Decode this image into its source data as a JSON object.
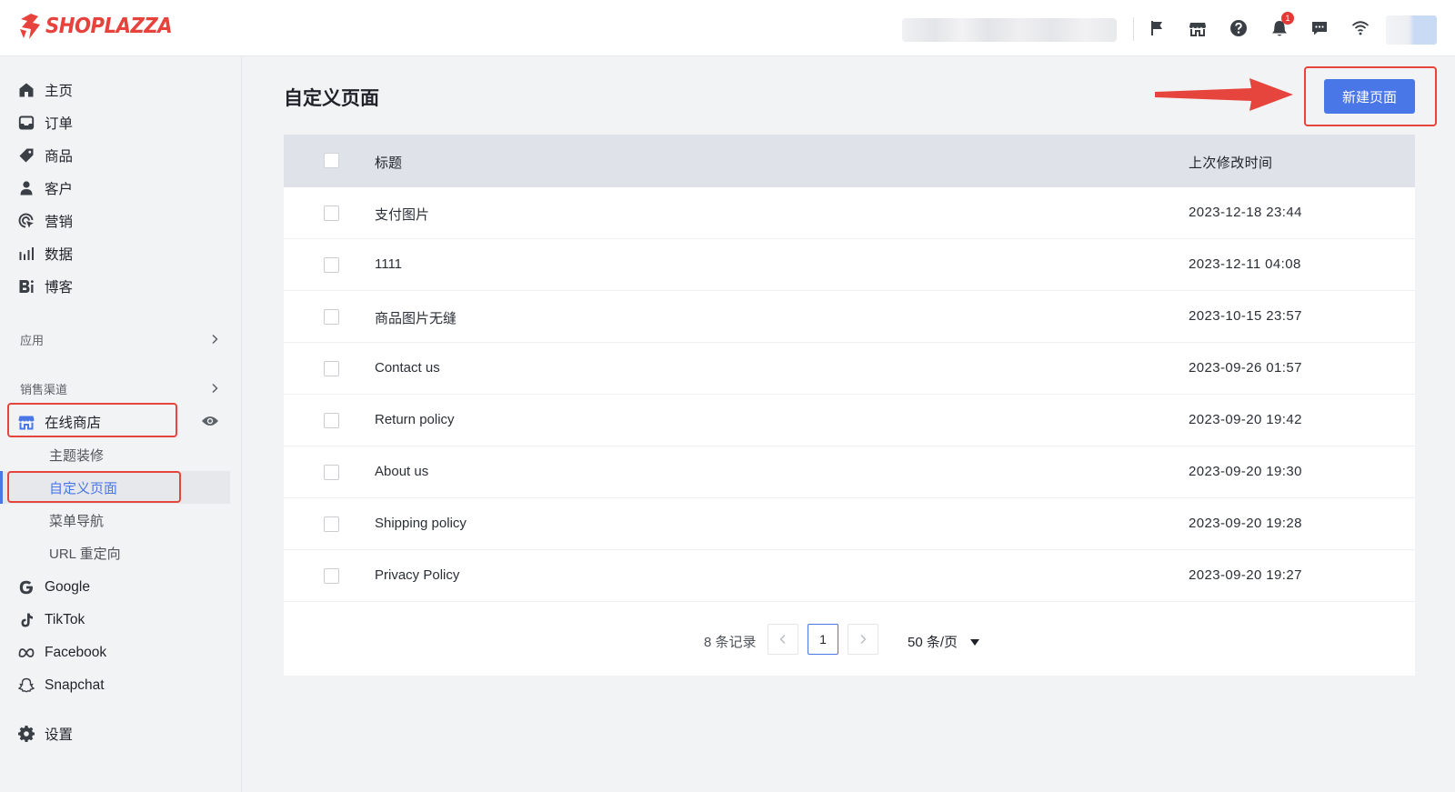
{
  "brand": {
    "name": "SHOPLAZZA",
    "color": "#e8423c",
    "accent": "#4a77e8",
    "highlight": "#e5453d"
  },
  "topbar": {
    "icons": [
      "flag-icon",
      "store-icon",
      "help-icon",
      "bell-icon",
      "message-icon",
      "wifi-icon"
    ],
    "notification_count": "1"
  },
  "sidebar": {
    "main_items": [
      {
        "label": "主页",
        "icon": "home-icon"
      },
      {
        "label": "订单",
        "icon": "inbox-icon"
      },
      {
        "label": "商品",
        "icon": "tag-icon"
      },
      {
        "label": "客户",
        "icon": "person-icon"
      },
      {
        "label": "营销",
        "icon": "marketing-icon"
      },
      {
        "label": "数据",
        "icon": "bar-chart-icon"
      },
      {
        "label": "博客",
        "icon": "blog-icon"
      }
    ],
    "apps_label": "应用",
    "channels_label": "销售渠道",
    "online_store": {
      "label": "在线商店",
      "sub_items": [
        "主题装修",
        "自定义页面",
        "菜单导航",
        "URL 重定向"
      ],
      "active_sub": "自定义页面"
    },
    "channels": [
      {
        "label": "Google",
        "icon": "google-icon"
      },
      {
        "label": "TikTok",
        "icon": "tiktok-icon"
      },
      {
        "label": "Facebook",
        "icon": "meta-icon"
      },
      {
        "label": "Snapchat",
        "icon": "snapchat-icon"
      }
    ],
    "settings_label": "设置"
  },
  "main": {
    "title": "自定义页面",
    "new_button": "新建页面",
    "table": {
      "columns": {
        "title": "标题",
        "modified": "上次修改时间"
      },
      "rows": [
        {
          "title": "支付图片",
          "modified": "2023-12-18 23:44"
        },
        {
          "title": "1111",
          "modified": "2023-12-11 04:08"
        },
        {
          "title": "商品图片无缝",
          "modified": "2023-10-15 23:57"
        },
        {
          "title": "Contact us",
          "modified": "2023-09-26 01:57"
        },
        {
          "title": "Return policy",
          "modified": "2023-09-20 19:42"
        },
        {
          "title": "About us",
          "modified": "2023-09-20 19:30"
        },
        {
          "title": "Shipping policy",
          "modified": "2023-09-20 19:28"
        },
        {
          "title": "Privacy Policy",
          "modified": "2023-09-20 19:27"
        }
      ]
    },
    "pagination": {
      "total": "8 条记录",
      "current_page": "1",
      "page_size": "50 条/页"
    }
  }
}
